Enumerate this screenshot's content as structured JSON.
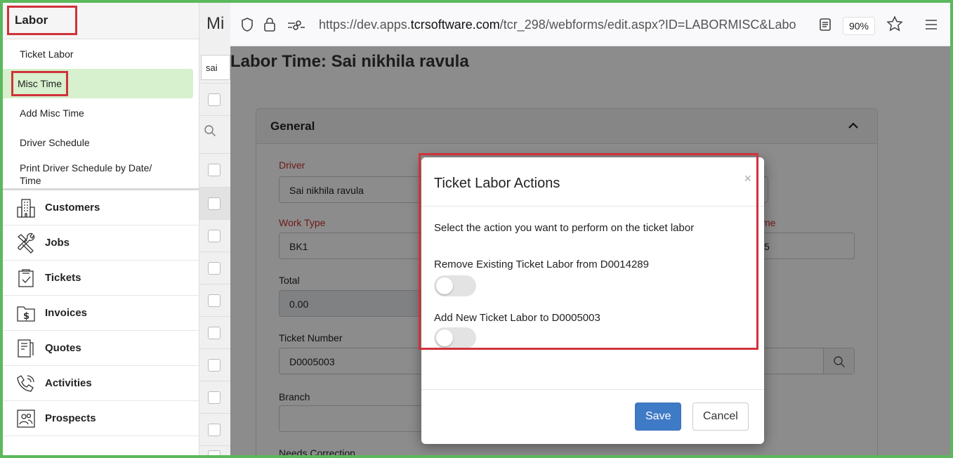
{
  "sidebar": {
    "header": "Labor",
    "sub_items": [
      "Ticket Labor",
      "Misc Time",
      "Add Misc Time",
      "Driver Schedule",
      "Print Driver Schedule by Date/ Time"
    ],
    "main_items": [
      {
        "label": "Customers",
        "icon": "building-icon"
      },
      {
        "label": "Jobs",
        "icon": "tools-icon"
      },
      {
        "label": "Tickets",
        "icon": "clipboard-check-icon"
      },
      {
        "label": "Invoices",
        "icon": "dollar-folder-icon"
      },
      {
        "label": "Quotes",
        "icon": "document-icon"
      },
      {
        "label": "Activities",
        "icon": "phone-icon"
      },
      {
        "label": "Prospects",
        "icon": "people-icon"
      }
    ]
  },
  "list": {
    "title": "Mi",
    "search_value": "sai"
  },
  "browser": {
    "url_prefix": "https://dev.apps.",
    "url_domain": "tcrsoftware.com",
    "url_rest": "/tcr_298/webforms/edit.aspx?ID=LABORMISC&Labo",
    "zoom": "90%"
  },
  "page": {
    "title": "Labor Time: Sai nikhila ravula",
    "section": "General",
    "fields": {
      "driver_label": "Driver",
      "driver_value": "Sai nikhila ravula",
      "work_type_label": "Work Type",
      "work_type_value": "BK1",
      "total_label": "Total",
      "total_value": "0.00",
      "ticket_number_label": "Ticket Number",
      "ticket_number_value": "D0005003",
      "branch_label": "Branch",
      "needs_correction_label": "Needs Correction",
      "partial_label": "me",
      "partial_value": "5"
    }
  },
  "modal": {
    "title": "Ticket Labor Actions",
    "close": "×",
    "prompt": "Select the action you want to perform on the ticket labor",
    "option1": "Remove Existing Ticket Labor from D0014289",
    "option2": "Add New Ticket Labor to D0005003",
    "save": "Save",
    "cancel": "Cancel"
  }
}
